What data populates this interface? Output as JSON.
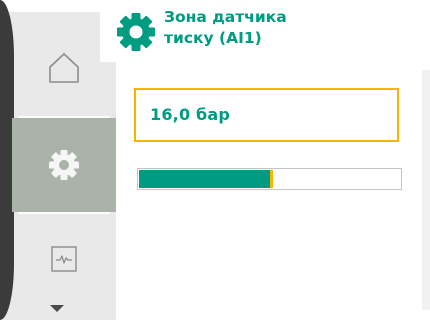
{
  "header": {
    "title_line1": "Зона датчика",
    "title_line2": "тиску (AI1)",
    "icon": "gear-icon",
    "title_color": "#009c82"
  },
  "sidebar": {
    "items": [
      {
        "id": "home",
        "icon": "home-icon",
        "active": false
      },
      {
        "id": "settings",
        "icon": "gear-icon",
        "active": true
      },
      {
        "id": "diagnostics",
        "icon": "pulse-icon",
        "active": false
      }
    ],
    "scroll_indicator_icon": "triangle-down-icon"
  },
  "main": {
    "value_display": "16,0 бар",
    "progress_fraction": 0.5,
    "accent_color": "#f5b700",
    "bar_color": "#009c82"
  }
}
